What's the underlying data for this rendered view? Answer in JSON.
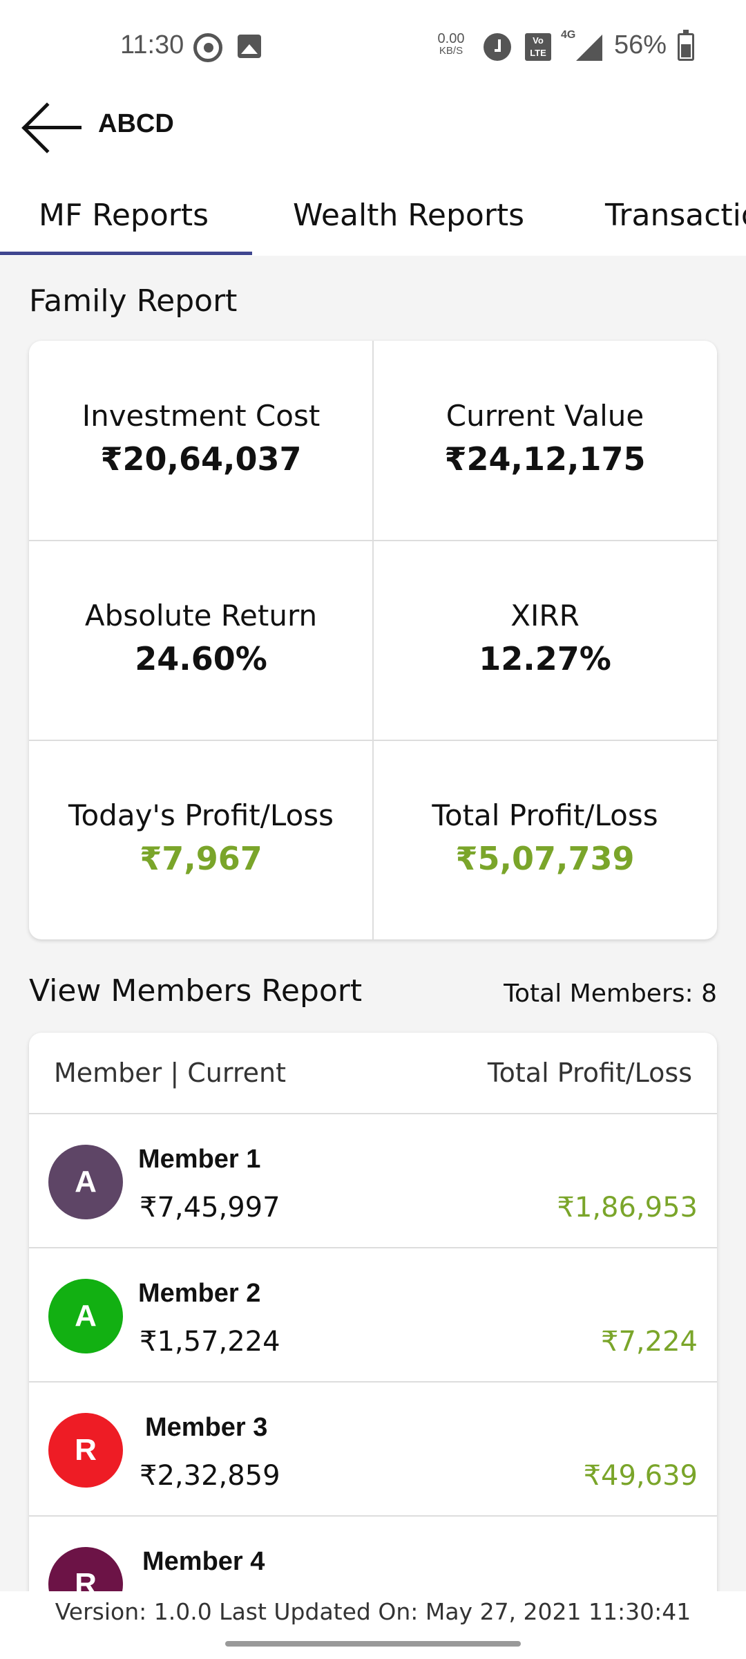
{
  "status_bar": {
    "time": "11:30",
    "net_speed_value": "0.00",
    "net_speed_unit": "KB/S",
    "volte": "VoLTE",
    "network": "4G",
    "battery": "56%",
    "icons": [
      "whatsapp-icon",
      "gallery-icon",
      "alarm-icon",
      "volte-icon",
      "signal-icon",
      "battery-icon"
    ]
  },
  "app_bar": {
    "title": "ABCD",
    "back_icon": "arrow-left-icon"
  },
  "tabs": [
    {
      "label": "MF Reports",
      "active": true
    },
    {
      "label": "Wealth Reports",
      "active": false
    },
    {
      "label": "Transactions",
      "active": false
    }
  ],
  "family_report": {
    "title": "Family Report",
    "cells": [
      {
        "label": "Investment Cost",
        "value": "₹20,64,037"
      },
      {
        "label": "Current Value",
        "value": "₹24,12,175"
      },
      {
        "label": "Absolute Return",
        "value": "24.60%"
      },
      {
        "label": "XIRR",
        "value": "12.27%"
      },
      {
        "label": "Today's Profit/Loss",
        "value": "₹7,967"
      },
      {
        "label": "Total Profit/Loss",
        "value": "₹5,07,739"
      }
    ]
  },
  "members_report": {
    "title": "View Members Report",
    "total_members": "Total Members: 8",
    "header_left": "Member | Current",
    "header_right": "Total Profit/Loss",
    "members": [
      {
        "initial": "A",
        "name": "Member 1",
        "current": "₹7,45,997",
        "profit_loss": "₹1,86,953",
        "color": "#5e4566"
      },
      {
        "initial": "A",
        "name": "Member 2",
        "current": "₹1,57,224",
        "profit_loss": "₹7,224",
        "color": "#12b012"
      },
      {
        "initial": "R",
        "name": "Member 3",
        "current": "₹2,32,859",
        "profit_loss": "₹49,639",
        "color": "#ee1c25"
      },
      {
        "initial": "R",
        "name": "Member 4",
        "current": "",
        "profit_loss": "",
        "color": "#6c1346"
      }
    ]
  },
  "footer": {
    "version_text": "Version: 1.0.0 Last Updated On: May 27, 2021 11:30:41"
  },
  "colors": {
    "accent": "#3f468f",
    "profit": "#7aa52a",
    "background": "#f4f4f4"
  }
}
